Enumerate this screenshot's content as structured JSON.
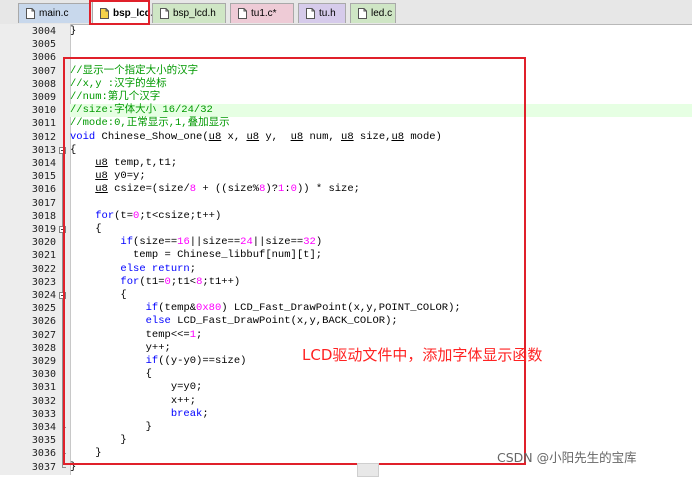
{
  "tabs": [
    {
      "label": "main.c",
      "color": "#c8d8ec",
      "active": false
    },
    {
      "label": "bsp_lcd.c*",
      "color": "#ffffff",
      "active": true
    },
    {
      "label": "bsp_lcd.h",
      "color": "#cfe6c5",
      "active": false
    },
    {
      "label": "tu1.c*",
      "color": "#eecbd6",
      "active": false
    },
    {
      "label": "tu.h",
      "color": "#d6cbeb",
      "active": false
    },
    {
      "label": "led.c",
      "color": "#cfe6c5",
      "active": false
    }
  ],
  "editor": {
    "lines": [
      {
        "n": "3004",
        "segs": [
          {
            "t": "}",
            "c": ""
          }
        ]
      },
      {
        "n": "3005",
        "segs": []
      },
      {
        "n": "3006",
        "segs": []
      },
      {
        "n": "3007",
        "segs": [
          {
            "t": "//显示一个指定大小的汉字",
            "c": "cm"
          }
        ]
      },
      {
        "n": "3008",
        "segs": [
          {
            "t": "//x,y :汉字的坐标",
            "c": "cm"
          }
        ]
      },
      {
        "n": "3009",
        "segs": [
          {
            "t": "//num:第几个汉字",
            "c": "cm"
          }
        ]
      },
      {
        "n": "3010",
        "segs": [
          {
            "t": "//size:字体大小 16/24/32",
            "c": "cm"
          }
        ]
      },
      {
        "n": "3011",
        "segs": [
          {
            "t": "//mode:0,正常显示,1,叠加显示",
            "c": "cm"
          }
        ]
      },
      {
        "n": "3012",
        "segs": [
          {
            "t": "void",
            "c": "kw"
          },
          {
            "t": " Chinese_Show_one(",
            "c": ""
          },
          {
            "t": "u8",
            "c": "ty"
          },
          {
            "t": " x, ",
            "c": ""
          },
          {
            "t": "u8",
            "c": "ty"
          },
          {
            "t": " y,  ",
            "c": ""
          },
          {
            "t": "u8",
            "c": "ty"
          },
          {
            "t": " num, ",
            "c": ""
          },
          {
            "t": "u8",
            "c": "ty"
          },
          {
            "t": " size,",
            "c": ""
          },
          {
            "t": "u8",
            "c": "ty"
          },
          {
            "t": " mode)",
            "c": ""
          }
        ]
      },
      {
        "n": "3013",
        "segs": [
          {
            "t": "{",
            "c": ""
          }
        ]
      },
      {
        "n": "3014",
        "segs": [
          {
            "t": "    ",
            "c": ""
          },
          {
            "t": "u8",
            "c": "ty"
          },
          {
            "t": " temp,t,t1;",
            "c": ""
          }
        ]
      },
      {
        "n": "3015",
        "segs": [
          {
            "t": "    ",
            "c": ""
          },
          {
            "t": "u8",
            "c": "ty"
          },
          {
            "t": " y0=y;",
            "c": ""
          }
        ]
      },
      {
        "n": "3016",
        "segs": [
          {
            "t": "    ",
            "c": ""
          },
          {
            "t": "u8",
            "c": "ty"
          },
          {
            "t": " csize=(size/",
            "c": ""
          },
          {
            "t": "8",
            "c": "nm"
          },
          {
            "t": " + ((size%",
            "c": ""
          },
          {
            "t": "8",
            "c": "nm"
          },
          {
            "t": ")?",
            "c": ""
          },
          {
            "t": "1",
            "c": "nm"
          },
          {
            "t": ":",
            "c": ""
          },
          {
            "t": "0",
            "c": "nm"
          },
          {
            "t": ")) * size;",
            "c": ""
          }
        ]
      },
      {
        "n": "3017",
        "segs": []
      },
      {
        "n": "3018",
        "segs": [
          {
            "t": "    ",
            "c": ""
          },
          {
            "t": "for",
            "c": "kw"
          },
          {
            "t": "(t=",
            "c": ""
          },
          {
            "t": "0",
            "c": "nm"
          },
          {
            "t": ";t<csize;t++)",
            "c": ""
          }
        ]
      },
      {
        "n": "3019",
        "segs": [
          {
            "t": "    {",
            "c": ""
          }
        ]
      },
      {
        "n": "3020",
        "segs": [
          {
            "t": "        ",
            "c": ""
          },
          {
            "t": "if",
            "c": "kw"
          },
          {
            "t": "(size==",
            "c": ""
          },
          {
            "t": "16",
            "c": "nm"
          },
          {
            "t": "||size==",
            "c": ""
          },
          {
            "t": "24",
            "c": "nm"
          },
          {
            "t": "||size==",
            "c": ""
          },
          {
            "t": "32",
            "c": "nm"
          },
          {
            "t": ")",
            "c": ""
          }
        ]
      },
      {
        "n": "3021",
        "segs": [
          {
            "t": "          temp = Chinese_libbuf[num][t];",
            "c": ""
          }
        ]
      },
      {
        "n": "3022",
        "segs": [
          {
            "t": "        ",
            "c": ""
          },
          {
            "t": "else return",
            "c": "kw"
          },
          {
            "t": ";",
            "c": ""
          }
        ]
      },
      {
        "n": "3023",
        "segs": [
          {
            "t": "        ",
            "c": ""
          },
          {
            "t": "for",
            "c": "kw"
          },
          {
            "t": "(t1=",
            "c": ""
          },
          {
            "t": "0",
            "c": "nm"
          },
          {
            "t": ";t1<",
            "c": ""
          },
          {
            "t": "8",
            "c": "nm"
          },
          {
            "t": ";t1++)",
            "c": ""
          }
        ]
      },
      {
        "n": "3024",
        "segs": [
          {
            "t": "        {",
            "c": ""
          }
        ]
      },
      {
        "n": "3025",
        "segs": [
          {
            "t": "            ",
            "c": ""
          },
          {
            "t": "if",
            "c": "kw"
          },
          {
            "t": "(temp&",
            "c": ""
          },
          {
            "t": "0x80",
            "c": "nm"
          },
          {
            "t": ") LCD_Fast_DrawPoint(x,y,POINT_COLOR);",
            "c": ""
          }
        ]
      },
      {
        "n": "3026",
        "segs": [
          {
            "t": "            ",
            "c": ""
          },
          {
            "t": "else",
            "c": "kw"
          },
          {
            "t": " LCD_Fast_DrawPoint(x,y,BACK_COLOR);",
            "c": ""
          }
        ]
      },
      {
        "n": "3027",
        "segs": [
          {
            "t": "            temp<<=",
            "c": ""
          },
          {
            "t": "1",
            "c": "nm"
          },
          {
            "t": ";",
            "c": ""
          }
        ]
      },
      {
        "n": "3028",
        "segs": [
          {
            "t": "            y++;",
            "c": ""
          }
        ]
      },
      {
        "n": "3029",
        "segs": [
          {
            "t": "            ",
            "c": ""
          },
          {
            "t": "if",
            "c": "kw"
          },
          {
            "t": "((y-y0)==size)",
            "c": ""
          }
        ]
      },
      {
        "n": "3030",
        "segs": [
          {
            "t": "            {",
            "c": ""
          }
        ]
      },
      {
        "n": "3031",
        "segs": [
          {
            "t": "                y=y0;",
            "c": ""
          }
        ]
      },
      {
        "n": "3032",
        "segs": [
          {
            "t": "                x++;",
            "c": ""
          }
        ]
      },
      {
        "n": "3033",
        "segs": [
          {
            "t": "                ",
            "c": ""
          },
          {
            "t": "break",
            "c": "kw"
          },
          {
            "t": ";",
            "c": ""
          }
        ]
      },
      {
        "n": "3034",
        "segs": [
          {
            "t": "            }",
            "c": ""
          }
        ]
      },
      {
        "n": "3035",
        "segs": [
          {
            "t": "        }",
            "c": ""
          }
        ]
      },
      {
        "n": "3036",
        "segs": [
          {
            "t": "    }",
            "c": ""
          }
        ]
      },
      {
        "n": "3037",
        "segs": [
          {
            "t": "}",
            "c": ""
          }
        ]
      }
    ],
    "highlighted_line": "3010"
  },
  "annotation": "LCD驱动文件中，添加字体显示函数",
  "watermark": "CSDN @小阳先生的宝库",
  "colors": {
    "highlight_box": "#e0202a",
    "comment": "#009900",
    "keyword": "#0000ff",
    "number": "#ff00ff"
  }
}
